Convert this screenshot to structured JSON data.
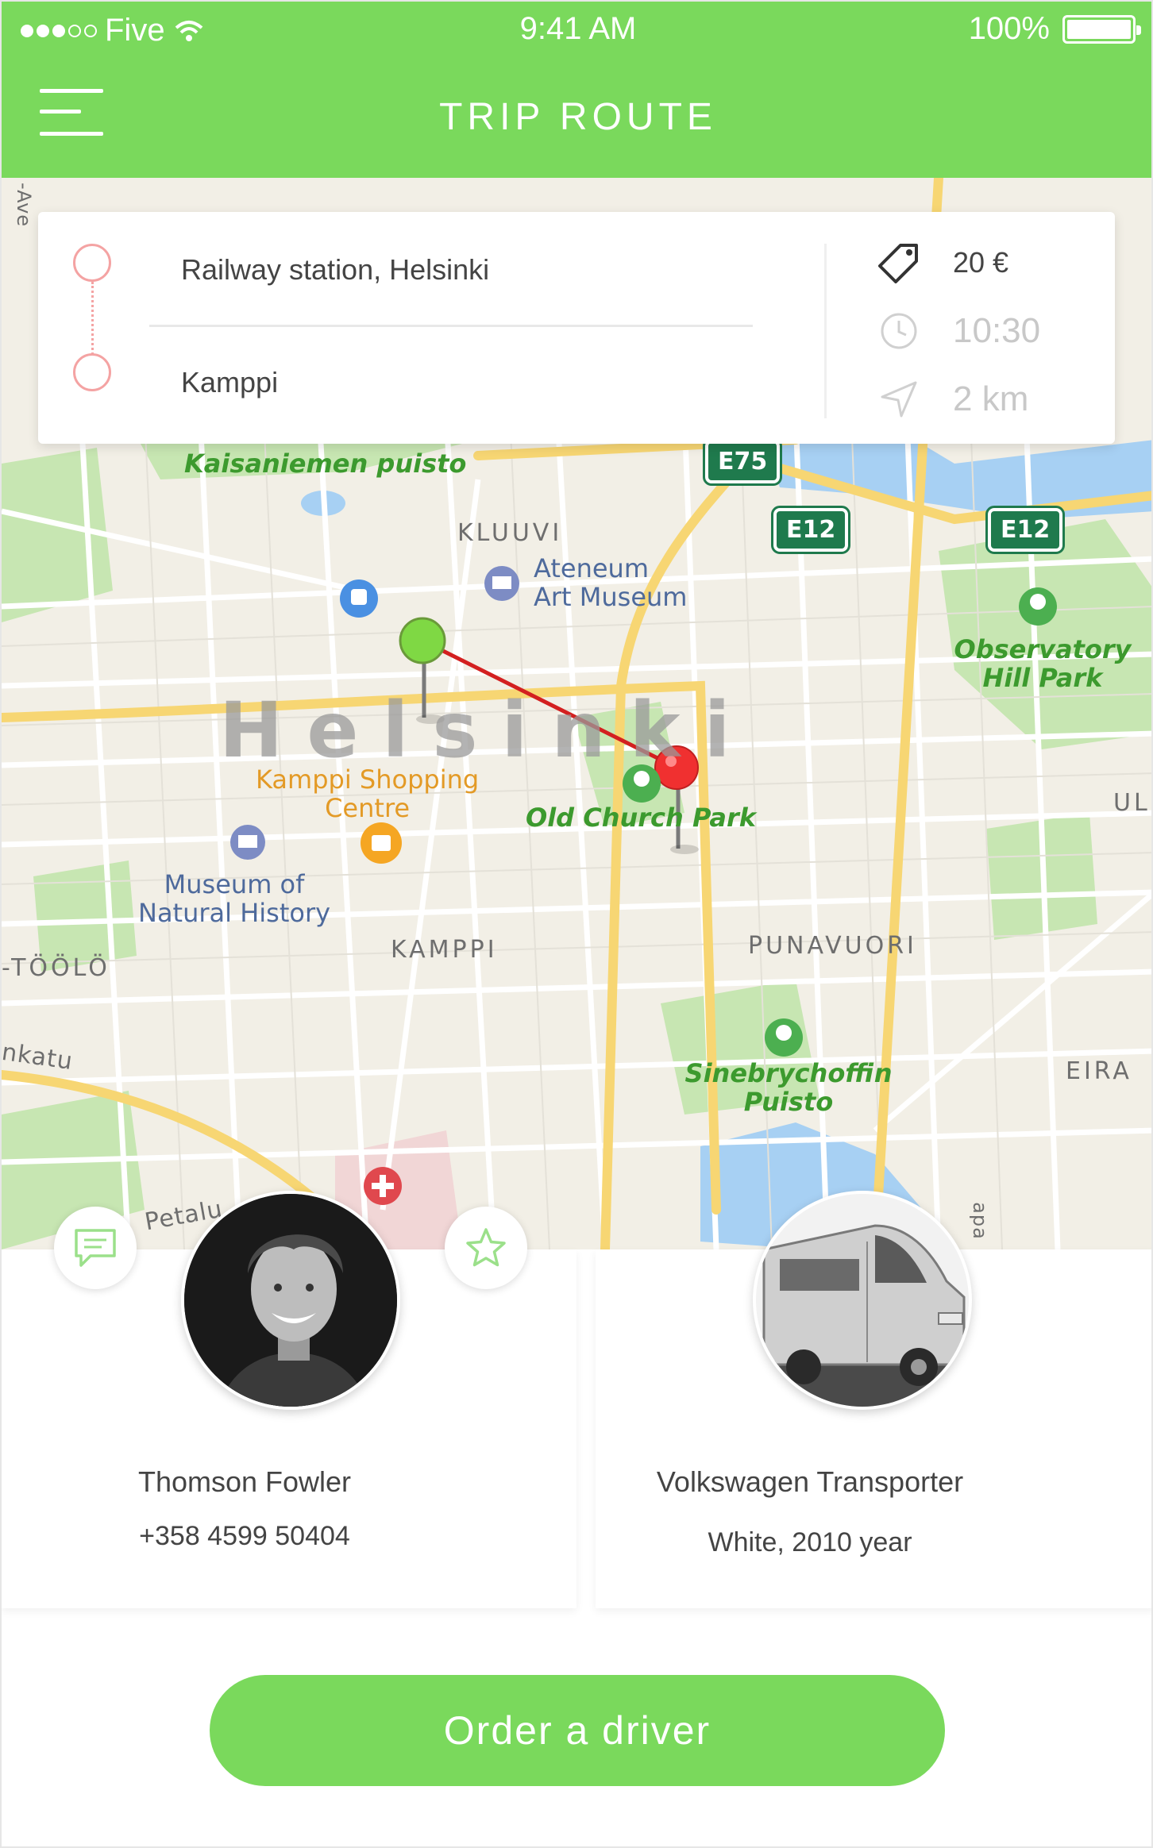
{
  "status_bar": {
    "carrier": "Five",
    "time": "9:41 AM",
    "battery": "100%"
  },
  "header": {
    "title": "TRIP ROUTE",
    "color": "#7ad95c"
  },
  "trip": {
    "from": "Railway station, Helsinki",
    "to": "Kamppi",
    "price": "20 €",
    "time": "10:30",
    "distance": "2 km",
    "route_color": "#f4a3a3"
  },
  "map": {
    "city": "Helsinki",
    "parks": [
      "Kaisaniemen puisto",
      "Observatory Hill Park",
      "Old Church Park",
      "Sinebrychoffin Puisto"
    ],
    "districts": [
      "KLUUVI",
      "KAMPPI",
      "PUNAVUORI",
      "EIRA",
      "-TÖÖLÖ",
      "UL"
    ],
    "pois": {
      "ateneum": "Ateneum\nArt Museum",
      "museum": "Museum of\nNatural History",
      "shopping": "Kamppi Shopping\nCentre"
    },
    "streets": [
      "nkatu",
      "Petalu",
      "-Ave",
      "apa"
    ],
    "roads": [
      "E75",
      "E12",
      "E12"
    ],
    "start_pin_color": "#7fd844",
    "end_pin_color": "#f03030"
  },
  "driver": {
    "name": "Thomson Fowler",
    "phone": "+358 4599 50404"
  },
  "vehicle": {
    "model": "Volkswagen Transporter",
    "description": "White, 2010 year"
  },
  "actions": {
    "chat_icon": "chat-icon",
    "favorite_icon": "star-icon",
    "order_label": "Order a driver"
  }
}
